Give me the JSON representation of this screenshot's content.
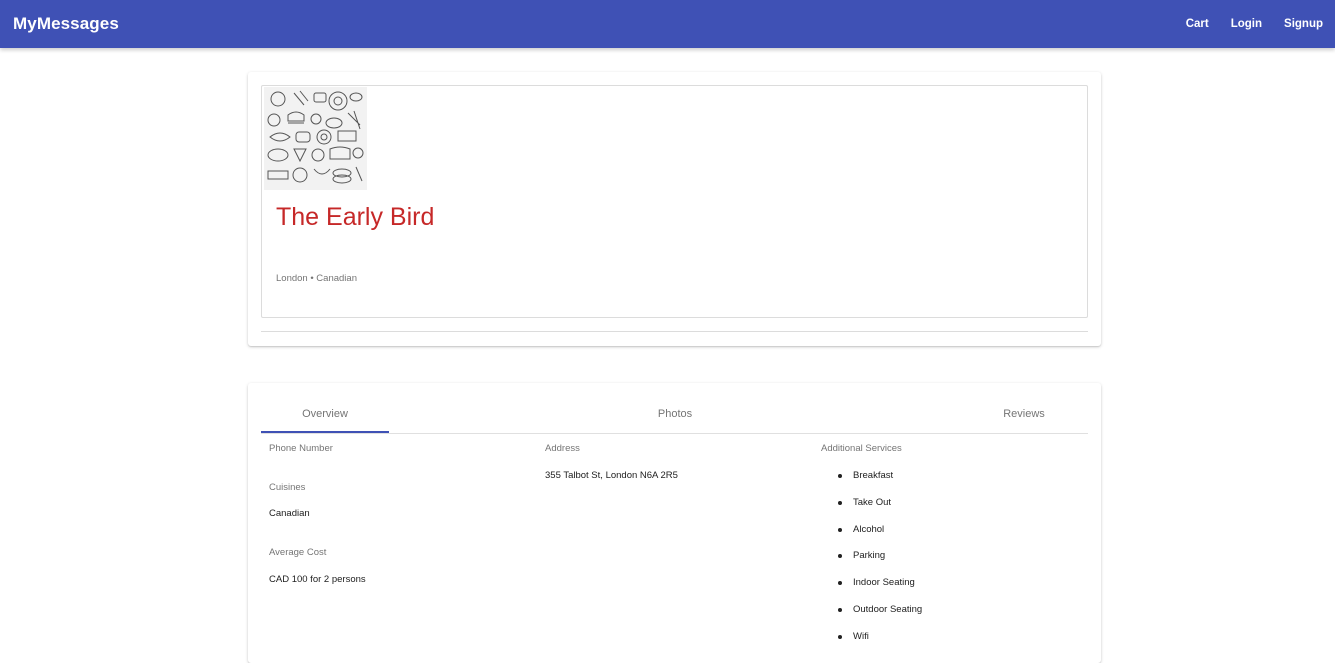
{
  "appbar": {
    "brand": "MyMessages",
    "links": [
      "Cart",
      "Login",
      "Signup"
    ]
  },
  "restaurant": {
    "image_icon": "food-doodle-image",
    "name": "The Early Bird",
    "meta": "London • Canadian"
  },
  "tabs": [
    "Overview",
    "Photos",
    "Reviews"
  ],
  "active_tab": "Overview",
  "overview": {
    "phone_label": "Phone Number",
    "phone_value": "",
    "cuisines_label": "Cuisines",
    "cuisines_value": "Canadian",
    "cost_label": "Average Cost",
    "cost_value": "CAD 100 for 2 persons",
    "address_label": "Address",
    "address_value": "355 Talbot St, London N6A 2R5",
    "services_label": "Additional Services",
    "services": [
      "Breakfast",
      "Take Out",
      "Alcohol",
      "Parking",
      "Indoor Seating",
      "Outdoor Seating",
      "Wifi"
    ]
  },
  "colors": {
    "primary": "#3f51b5",
    "title": "#c62828"
  }
}
